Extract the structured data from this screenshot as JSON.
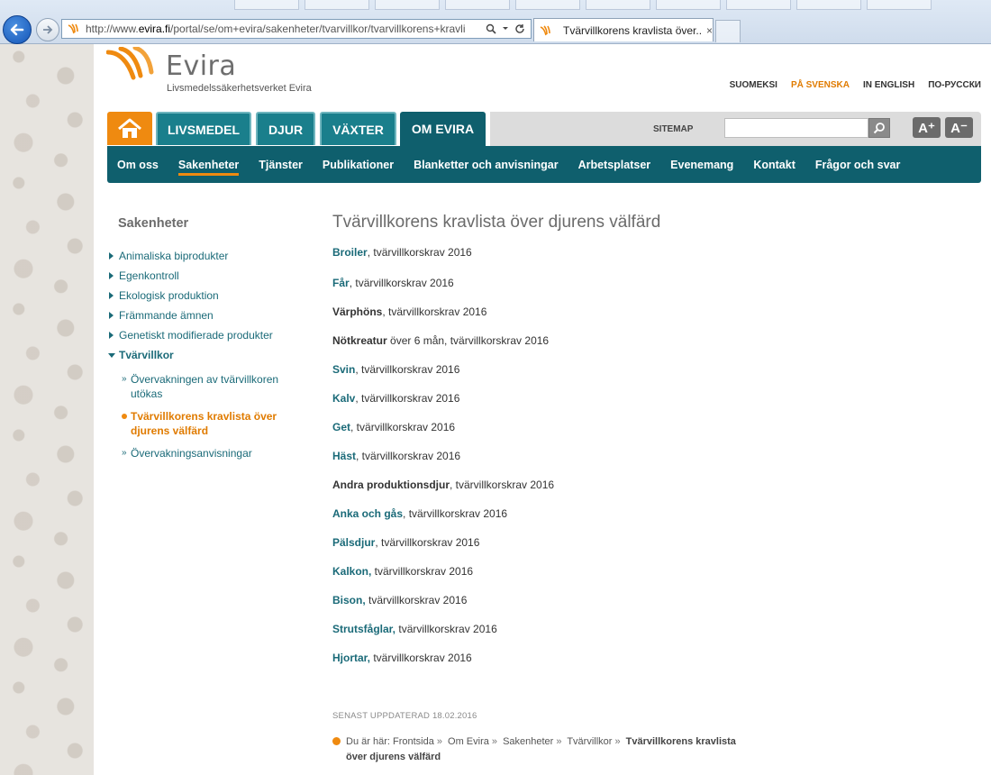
{
  "browser": {
    "url_prefix": "http://www.",
    "url_domain": "evira.fi",
    "url_rest": "/portal/se/om+evira/sakenheter/tvarvillkor/tvarvillkorens+kravli",
    "tab_title": "Tvärvillkorens kravlista över...",
    "tab_close": "×"
  },
  "header": {
    "logo_name": "Evira",
    "logo_sub": "Livsmedelssäkerhetsverket Evira",
    "colors": {
      "orange": "#ef8a10",
      "teal": "#1a7f8c",
      "dark_teal": "#0f5f6d"
    }
  },
  "languages": [
    {
      "label": "SUOMEKSI"
    },
    {
      "label": "PÅ SVENSKA"
    },
    {
      "label": "IN ENGLISH"
    },
    {
      "label": "ПО-РУССКИ"
    }
  ],
  "main_nav": {
    "tabs": [
      "LIVSMEDEL",
      "DJUR",
      "VÄXTER",
      "OM EVIRA"
    ],
    "sitemap": "SITEMAP",
    "font_increase": "A⁺",
    "font_decrease": "A⁻"
  },
  "sub_nav": [
    "Om oss",
    "Sakenheter",
    "Tjänster",
    "Publikationer",
    "Blanketter och anvisningar",
    "Arbetsplatser",
    "Evenemang",
    "Kontakt",
    "Frågor och svar"
  ],
  "sidebar": {
    "heading": "Sakenheter",
    "items": [
      "Animaliska biprodukter",
      "Egenkontroll",
      "Ekologisk produktion",
      "Främmande ämnen",
      "Genetiskt modifierade produkter",
      "Tvärvillkor"
    ],
    "sub_items": [
      "Övervakningen av tvärvillkoren utökas",
      "Tvärvillkorens kravlista över djurens välfärd",
      "Övervakningsanvisningar"
    ]
  },
  "content": {
    "title": "Tvärvillkorens kravlista över djurens välfärd",
    "items": [
      {
        "link": "Broiler",
        "text": ", tvärvillkorskrav 2016"
      },
      {
        "link": "Får",
        "text": ", tvärvillkorskrav 2016"
      },
      {
        "link": "Värphöns",
        "text": ", tvärvillkorskrav 2016"
      },
      {
        "link": "Nötkreatur",
        "text": " över 6 mån, tvärvillkorskrav 2016"
      },
      {
        "link": "Svin",
        "text": ", tvärvillkorskrav 2016"
      },
      {
        "link": "Kalv",
        "text": ", tvärvillkorskrav 2016"
      },
      {
        "link": "Get",
        "text": ", tvärvillkorskrav 2016"
      },
      {
        "link": "Häst",
        "text": ", tvärvillkorskrav 2016"
      },
      {
        "link": "Andra produktionsdjur",
        "text": ", tvärvillkorskrav 2016"
      },
      {
        "link": "Anka och gås",
        "text": ", tvärvillkorskrav 2016"
      },
      {
        "link": "Pälsdjur",
        "text": ", tvärvillkorskrav 2016"
      },
      {
        "link": "Kalkon,",
        "text": " tvärvillkorskrav 2016"
      },
      {
        "link": "Bison,",
        "text": " tvärvillkorskrav 2016"
      },
      {
        "link": "Strutsfåglar,",
        "text": " tvärvillkorskrav 2016"
      },
      {
        "link": "Hjortar,",
        "text": " tvärvillkorskrav 2016"
      }
    ],
    "updated": "SENAST UPPDATERAD 18.02.2016"
  },
  "breadcrumb": {
    "prefix": "Du är här:",
    "items": [
      "Frontsida",
      "Om Evira",
      "Sakenheter",
      "Tvärvillkor"
    ],
    "current": "Tvärvillkorens kravlista över djurens välfärd",
    "sep": "»"
  }
}
